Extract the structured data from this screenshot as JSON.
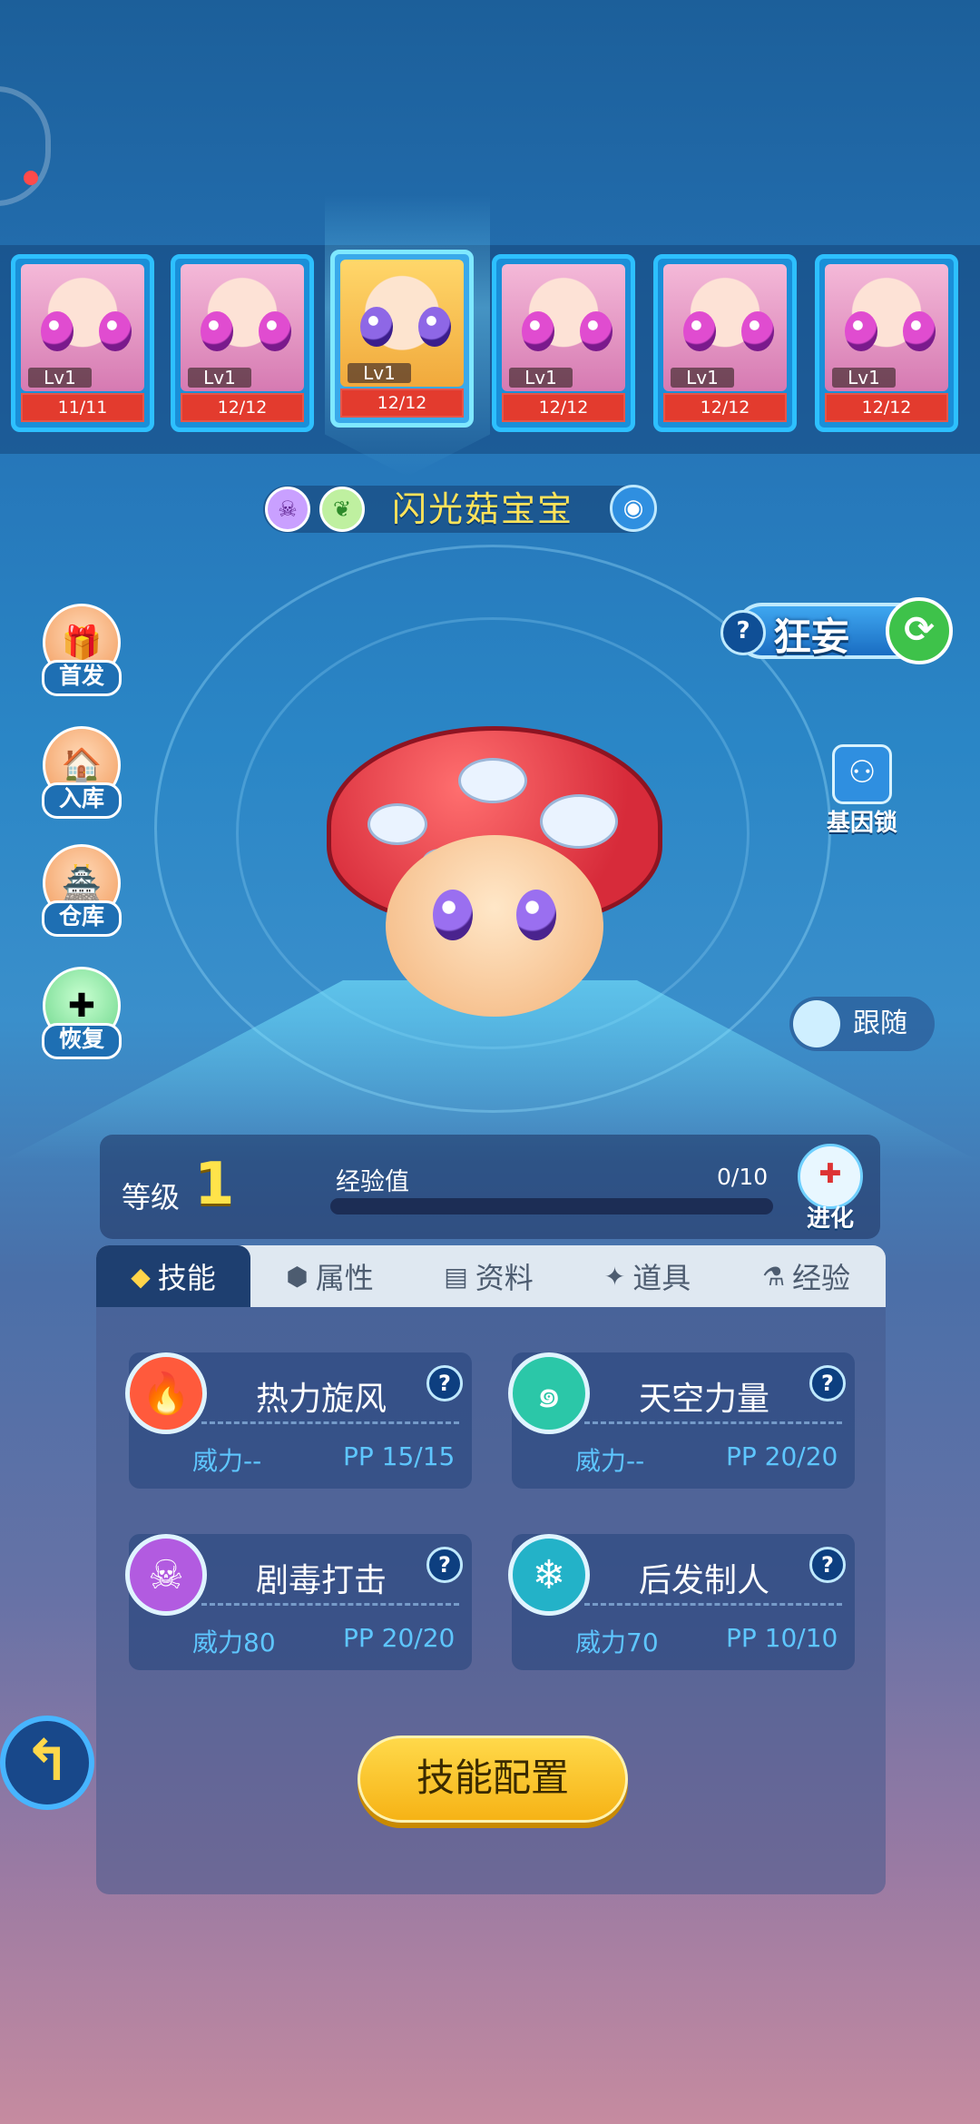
{
  "team": [
    {
      "level": "Lv1",
      "hp": "11/11",
      "selected": false
    },
    {
      "level": "Lv1",
      "hp": "12/12",
      "selected": false
    },
    {
      "level": "Lv1",
      "hp": "12/12",
      "selected": true
    },
    {
      "level": "Lv1",
      "hp": "12/12",
      "selected": false
    },
    {
      "level": "Lv1",
      "hp": "12/12",
      "selected": false
    },
    {
      "level": "Lv1",
      "hp": "12/12",
      "selected": false
    }
  ],
  "pet": {
    "name": "闪光菇宝宝",
    "element_icons": [
      "skull-icon",
      "leaf-icon"
    ],
    "nature": "狂妄"
  },
  "left_menu": [
    "首发",
    "入库",
    "仓库",
    "恢复"
  ],
  "right_menu": {
    "gene_lock": "基因锁",
    "follow": "跟随"
  },
  "stats": {
    "level_label": "等级",
    "level": "1",
    "exp_label": "经验值",
    "exp": "0/10",
    "exp_fraction": 0,
    "evolve": "进化"
  },
  "tabs": [
    "技能",
    "属性",
    "资料",
    "道具",
    "经验"
  ],
  "skills": [
    {
      "name": "热力旋风",
      "power": "威力--",
      "pp": "PP 15/15",
      "icon": "fire-icon",
      "color": "#ff5a3c"
    },
    {
      "name": "天空力量",
      "power": "威力--",
      "pp": "PP 20/20",
      "icon": "wind-icon",
      "color": "#2bc7a8"
    },
    {
      "name": "剧毒打击",
      "power": "威力80",
      "pp": "PP 20/20",
      "icon": "skull-icon",
      "color": "#b25be0"
    },
    {
      "name": "后发制人",
      "power": "威力70",
      "pp": "PP 10/10",
      "icon": "snowflake-icon",
      "color": "#23b2c8"
    }
  ],
  "config_button": "技能配置",
  "colors": {
    "accent": "#ffd94a",
    "hp_bar": "#e33b2e",
    "exp_fill": "#5ad5ff"
  }
}
